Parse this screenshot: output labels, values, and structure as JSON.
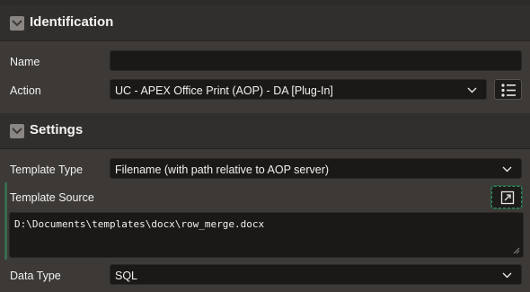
{
  "identification": {
    "title": "Identification",
    "name_label": "Name",
    "name_value": "",
    "action_label": "Action",
    "action_value": "UC - APEX Office Print (AOP) - DA [Plug-In]",
    "list_icon": "list-icon"
  },
  "settings": {
    "title": "Settings",
    "template_type_label": "Template Type",
    "template_type_value": "Filename (with path relative to AOP server)",
    "template_source_label": "Template Source",
    "template_source_value": "D:\\Documents\\templates\\docx\\row_merge.docx",
    "data_type_label": "Data Type",
    "data_type_value": "SQL",
    "expand_icon": "open-in-dialog-icon"
  },
  "colors": {
    "background": "#3c3936",
    "header": "#312f2d",
    "field": "#1a1918",
    "accent": "#3a8a60"
  }
}
